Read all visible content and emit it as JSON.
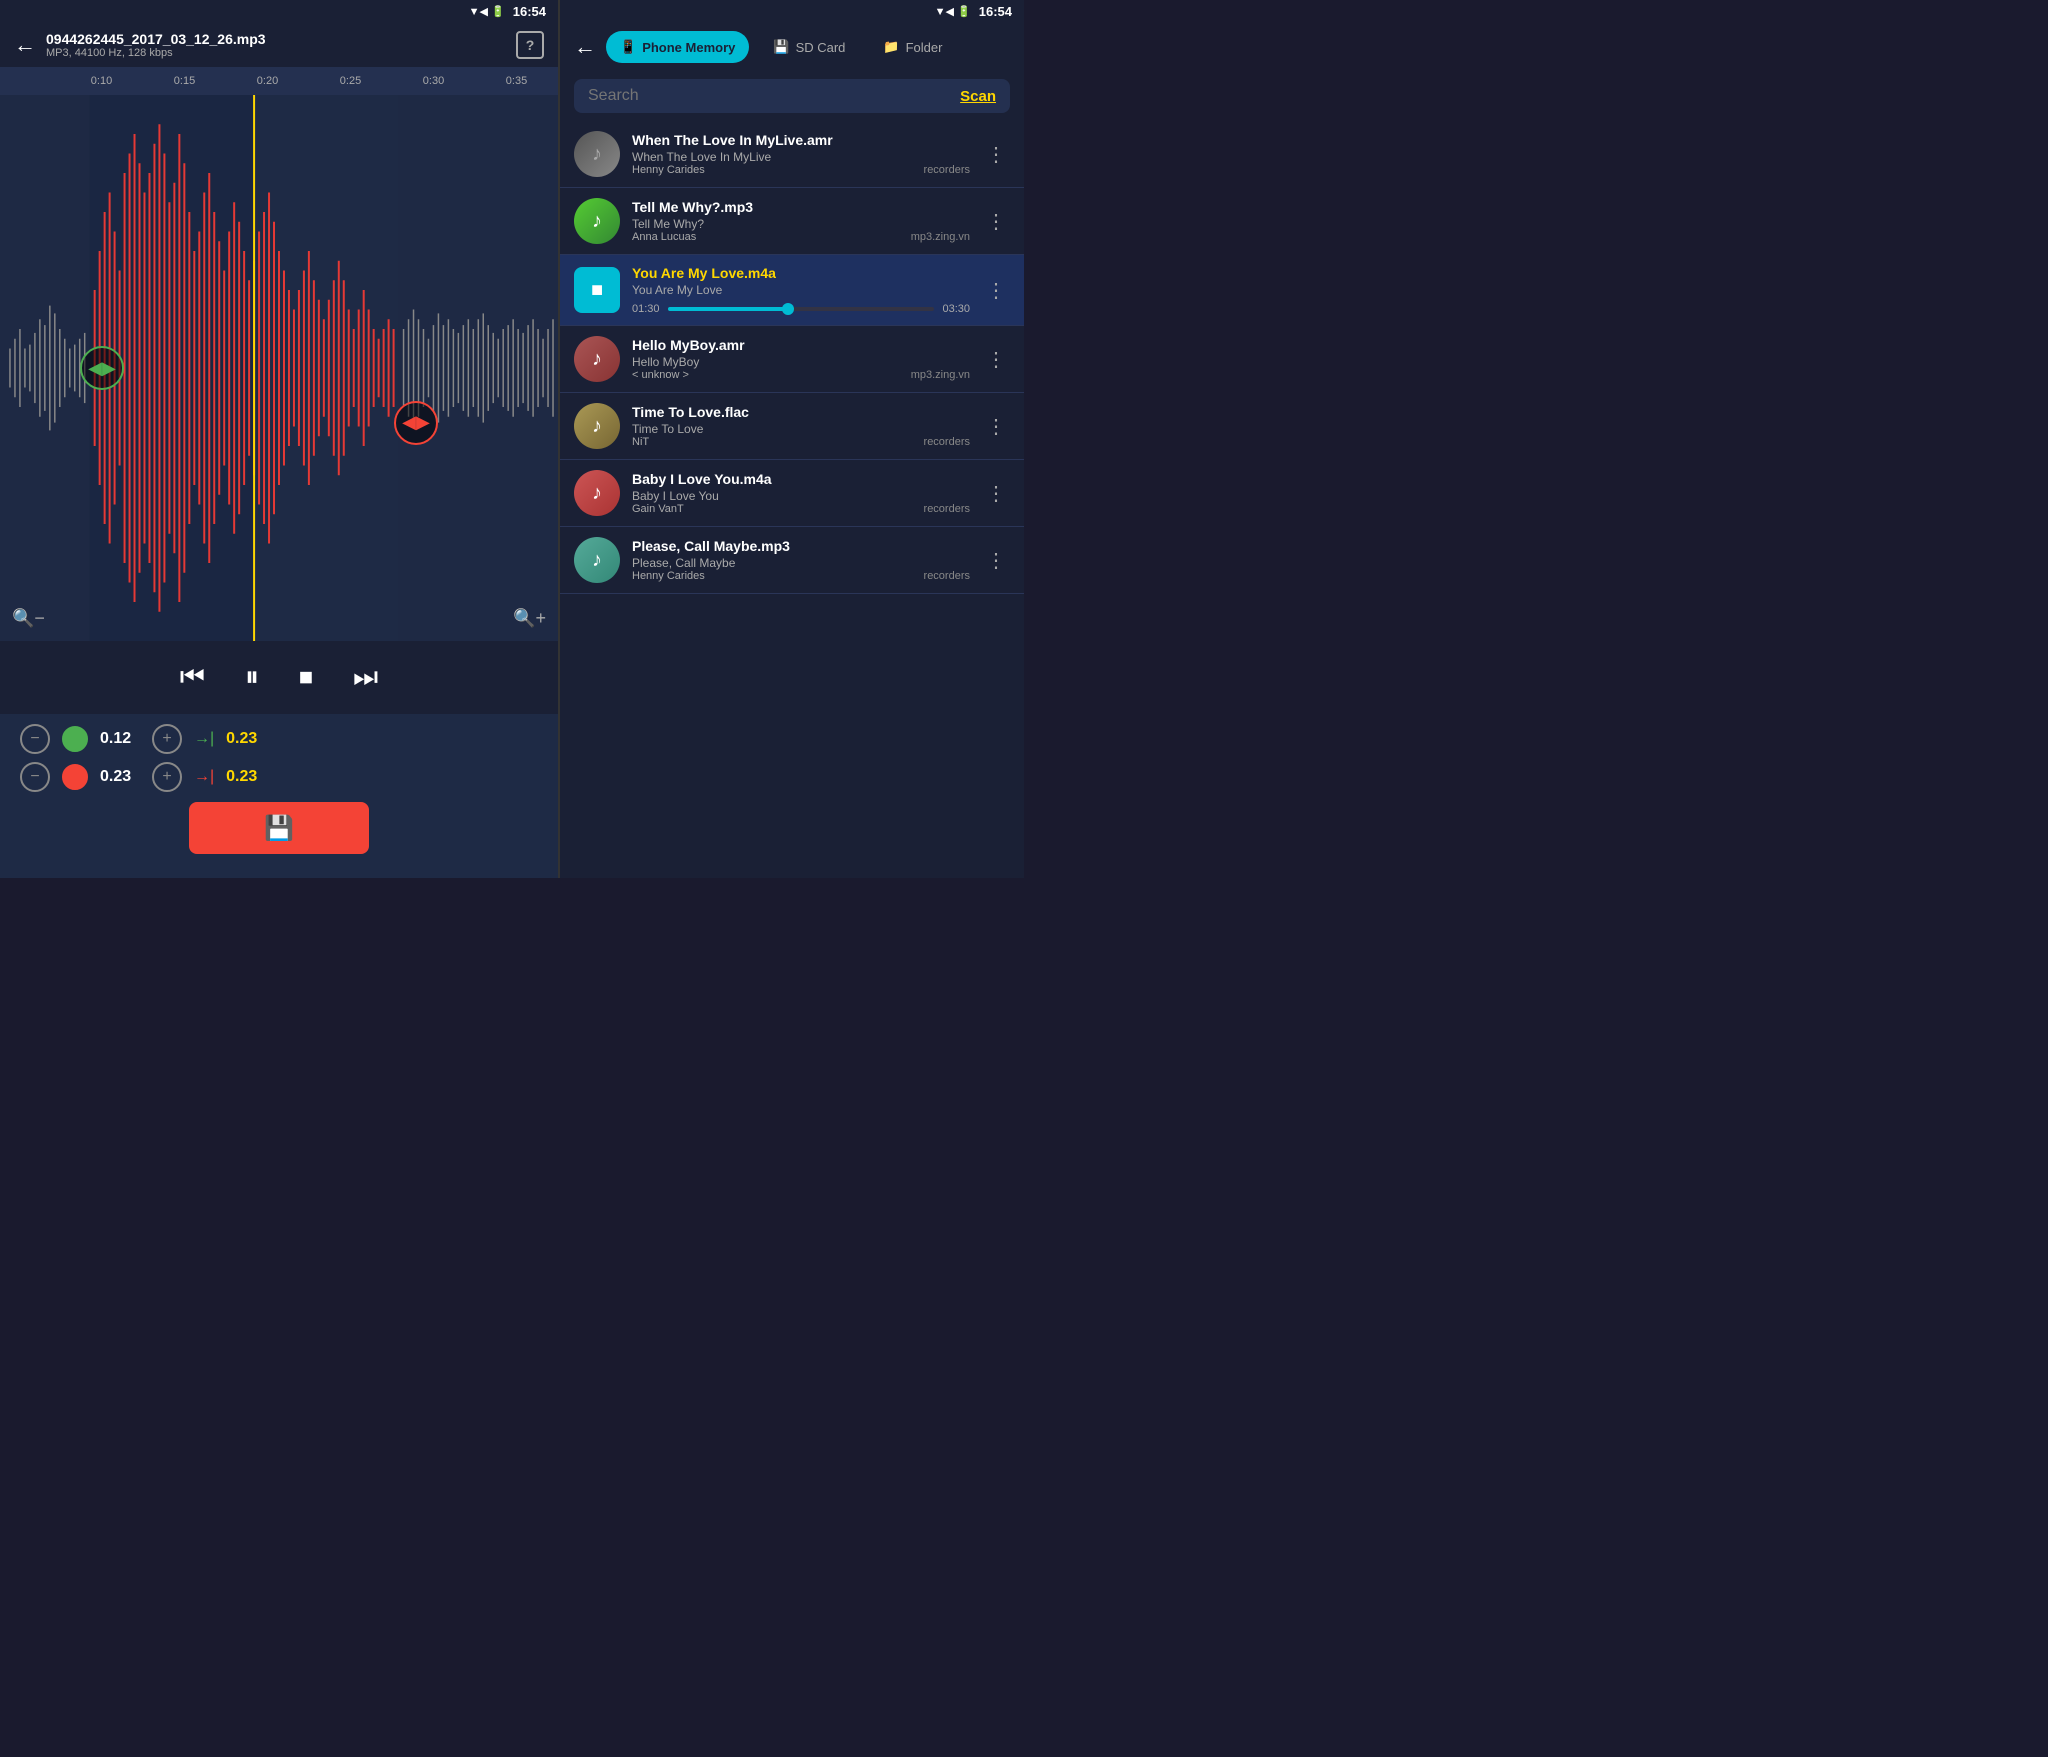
{
  "left": {
    "status": {
      "time": "16:54",
      "icons": "▼◀ 🔋"
    },
    "header": {
      "back": "←",
      "filename": "0944262445_2017_03_12_26.mp3",
      "meta": "MP3, 44100 Hz, 128 kbps",
      "help": "?"
    },
    "timeline": {
      "marks": [
        "0:10",
        "0:15",
        "0:20",
        "0:25",
        "0:30",
        "0:35"
      ]
    },
    "handles": {
      "left_icon": "◀▶",
      "right_icon": "◀▶"
    },
    "transport": {
      "rewind": "⏮",
      "pause": "⏸",
      "stop": "⏹",
      "forward": "⏭"
    },
    "edit": {
      "row1": {
        "minus": "−",
        "plus": "+",
        "value": "0.12",
        "arrow": "→|",
        "yellow_val": "0.23"
      },
      "row2": {
        "minus": "−",
        "plus": "+",
        "value": "0.23",
        "arrow": "→|",
        "yellow_val": "0.23"
      }
    },
    "save_icon": "💾"
  },
  "right": {
    "status": {
      "time": "16:54"
    },
    "header": {
      "back": "←",
      "tabs": [
        {
          "label": "Phone Memory",
          "active": true,
          "icon": "📱"
        },
        {
          "label": "SD Card",
          "active": false,
          "icon": "💾"
        },
        {
          "label": "Folder",
          "active": false,
          "icon": "📁"
        }
      ]
    },
    "search": {
      "placeholder": "Search",
      "scan_label": "Scan"
    },
    "songs": [
      {
        "title": "When The Love In MyLive.amr",
        "subtitle": "When The Love In MyLive",
        "artist": "Henny Carides",
        "source": "recorders",
        "playing": false,
        "avatar_class": "avatar-1"
      },
      {
        "title": "Tell Me Why?.mp3",
        "subtitle": "Tell Me Why?",
        "artist": "Anna Lucuas",
        "source": "mp3.zing.vn",
        "playing": false,
        "avatar_class": "avatar-2"
      },
      {
        "title": "You Are My Love.m4a",
        "subtitle": "You Are My Love",
        "artist": "",
        "source": "",
        "playing": true,
        "time_current": "01:30",
        "time_total": "03:30",
        "avatar_class": "avatar-3"
      },
      {
        "title": "Hello MyBoy.amr",
        "subtitle": "Hello MyBoy",
        "artist": "< unknow >",
        "source": "mp3.zing.vn",
        "playing": false,
        "avatar_class": "avatar-4"
      },
      {
        "title": "Time To Love.flac",
        "subtitle": "Time To Love",
        "artist": "NiT",
        "source": "recorders",
        "playing": false,
        "avatar_class": "avatar-5"
      },
      {
        "title": "Baby I Love You.m4a",
        "subtitle": "Baby I Love You",
        "artist": "Gain VanT",
        "source": "recorders",
        "playing": false,
        "avatar_class": "avatar-6"
      },
      {
        "title": "Please, Call Maybe.mp3",
        "subtitle": "Please, Call Maybe",
        "artist": "Henny Carides",
        "source": "recorders",
        "playing": false,
        "avatar_class": "avatar-7"
      }
    ]
  }
}
